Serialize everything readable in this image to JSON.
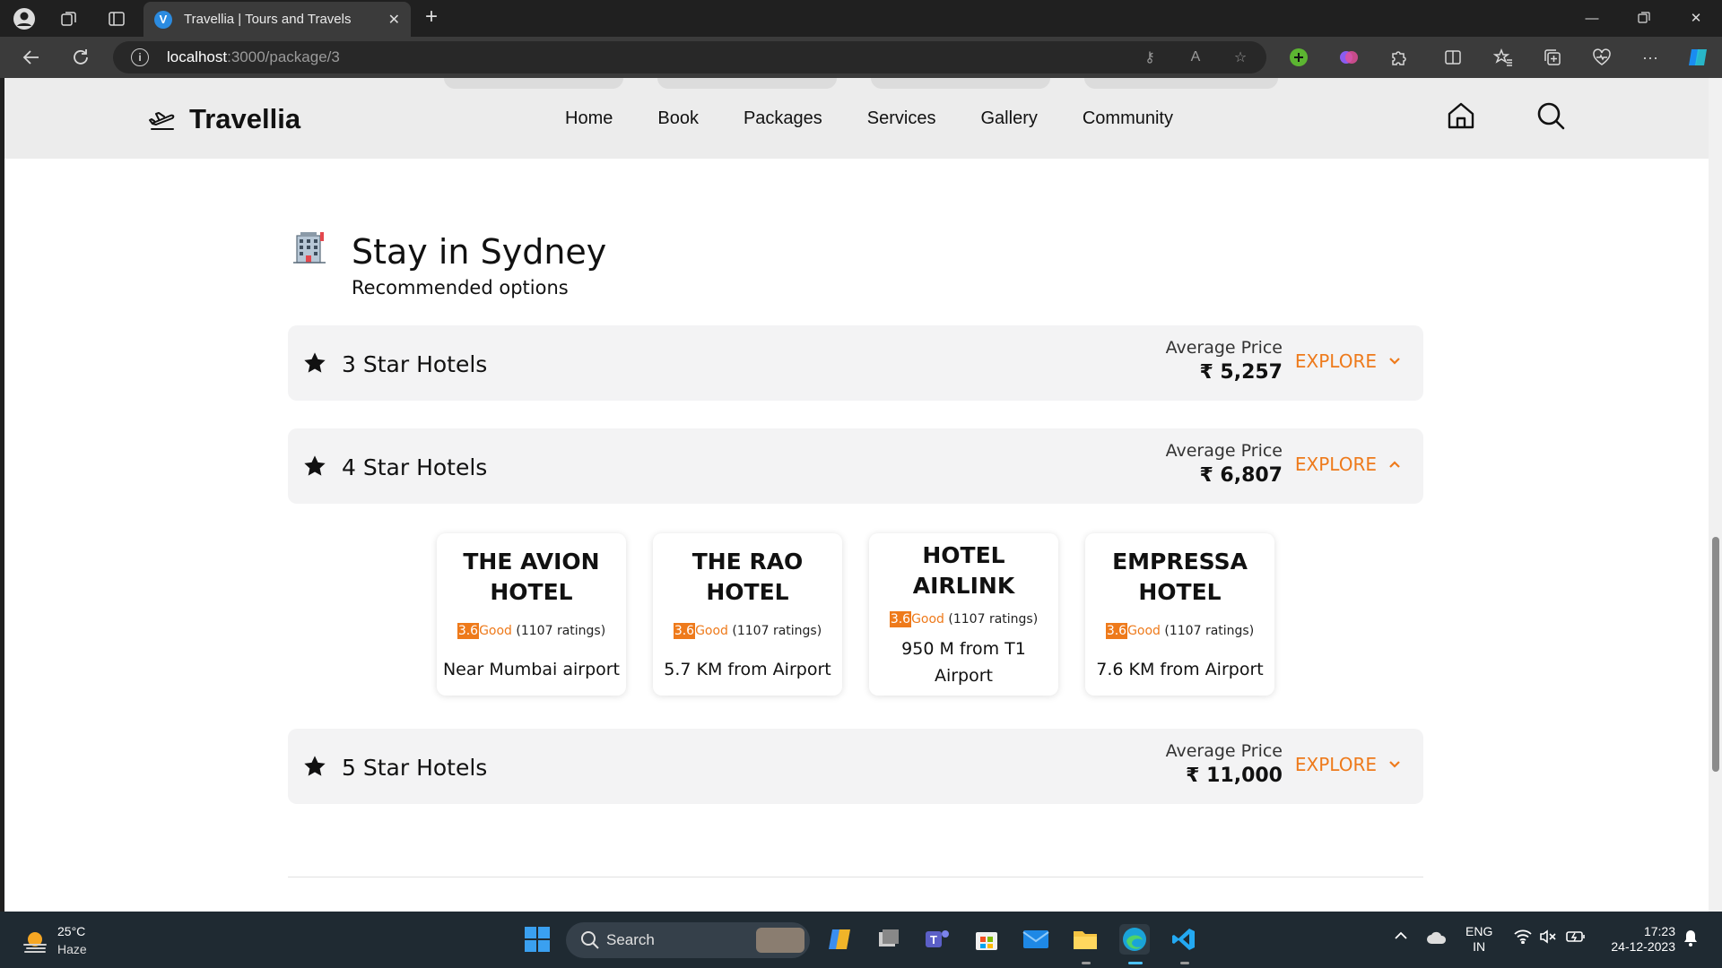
{
  "browser": {
    "tab_title": "Travellia | Tours and Travels",
    "tab_favicon_letter": "V",
    "url_host": "localhost",
    "url_path": ":3000/package/3"
  },
  "site": {
    "brand": "Travellia",
    "nav": [
      "Home",
      "Book",
      "Packages",
      "Services",
      "Gallery",
      "Community"
    ]
  },
  "section": {
    "title": "Stay in Sydney",
    "subtitle": "Recommended options"
  },
  "accordions": [
    {
      "title": "3 Star Hotels",
      "price_label": "Average Price",
      "price": "₹ 5,257",
      "explore": "EXPLORE",
      "expanded": false
    },
    {
      "title": "4 Star Hotels",
      "price_label": "Average Price",
      "price": "₹ 6,807",
      "explore": "EXPLORE",
      "expanded": true
    },
    {
      "title": "5 Star Hotels",
      "price_label": "Average Price",
      "price": "₹ 11,000",
      "explore": "EXPLORE",
      "expanded": false
    }
  ],
  "hotels": [
    {
      "name": "THE AVION HOTEL",
      "score": "3.6",
      "rating_word": "Good",
      "ratings": "(1107 ratings)",
      "distance": "Near Mumbai airport"
    },
    {
      "name": "THE RAO HOTEL",
      "score": "3.6",
      "rating_word": "Good",
      "ratings": "(1107 ratings)",
      "distance": "5.7 KM from Airport"
    },
    {
      "name": "HOTEL AIRLINK",
      "score": "3.6",
      "rating_word": "Good",
      "ratings": "(1107 ratings)",
      "distance": "950 M from T1 Airport"
    },
    {
      "name": "EMPRESSA HOTEL",
      "score": "3.6",
      "rating_word": "Good",
      "ratings": "(1107 ratings)",
      "distance": "7.6 KM from Airport"
    }
  ],
  "taskbar": {
    "temperature": "25°C",
    "weather": "Haze",
    "search_placeholder": "Search",
    "lang_1": "ENG",
    "lang_2": "IN",
    "time": "17:23",
    "date": "24-12-2023"
  },
  "colors": {
    "accent": "#ee7a1b",
    "accordion_bg": "#f3f3f4",
    "header_bg": "#ececec"
  }
}
